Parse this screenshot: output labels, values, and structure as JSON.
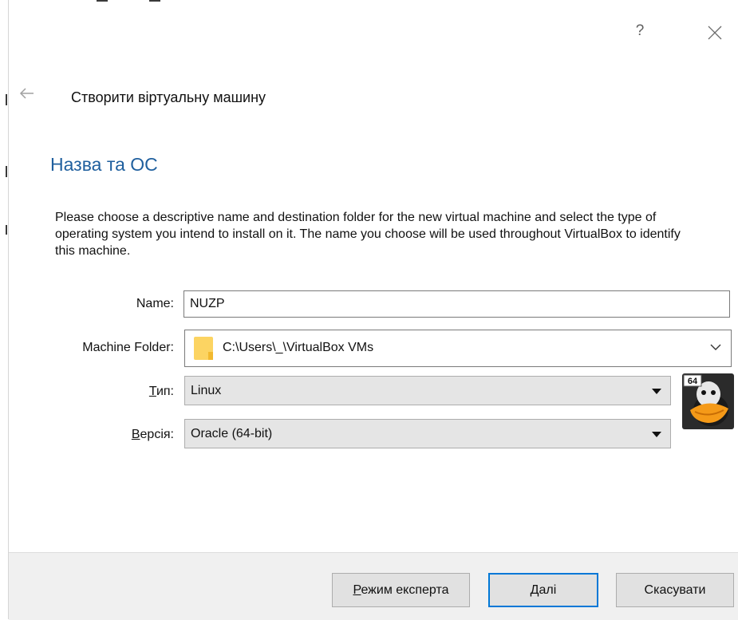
{
  "window": {
    "help_glyph": "?",
    "close_icon": "close-icon",
    "back_icon": "arrow-left-icon"
  },
  "wizard": {
    "title": "Створити віртуальну машину",
    "section_title": "Назва та ОС",
    "description": "Please choose a descriptive name and destination folder for the new virtual machine and select the type of operating system you intend to install on it. The name you choose will be used throughout VirtualBox to identify this machine."
  },
  "form": {
    "name": {
      "label": "Name:",
      "value": "NUZP"
    },
    "machine_folder": {
      "label": "Machine Folder:",
      "value": "C:\\Users\\_\\VirtualBox VMs",
      "icon": "folder-icon"
    },
    "type": {
      "label_accel": "Т",
      "label_rest": "ип:",
      "value": "Linux"
    },
    "version": {
      "label_accel": "В",
      "label_rest": "ерсія:",
      "value": "Oracle (64-bit)"
    },
    "os_icon": {
      "badge": "64",
      "icon": "linux-penguin-icon"
    }
  },
  "buttons": {
    "expert": {
      "accel": "Р",
      "rest": "ежим експерта"
    },
    "next": {
      "accel": "Д",
      "rest": "алі"
    },
    "cancel": {
      "label": "Скасувати"
    }
  },
  "colors": {
    "section_title": "#1f5f9e",
    "default_button_border": "#0078d7",
    "select_background": "#e5e5e5",
    "footer_background": "#f0f0f0"
  }
}
